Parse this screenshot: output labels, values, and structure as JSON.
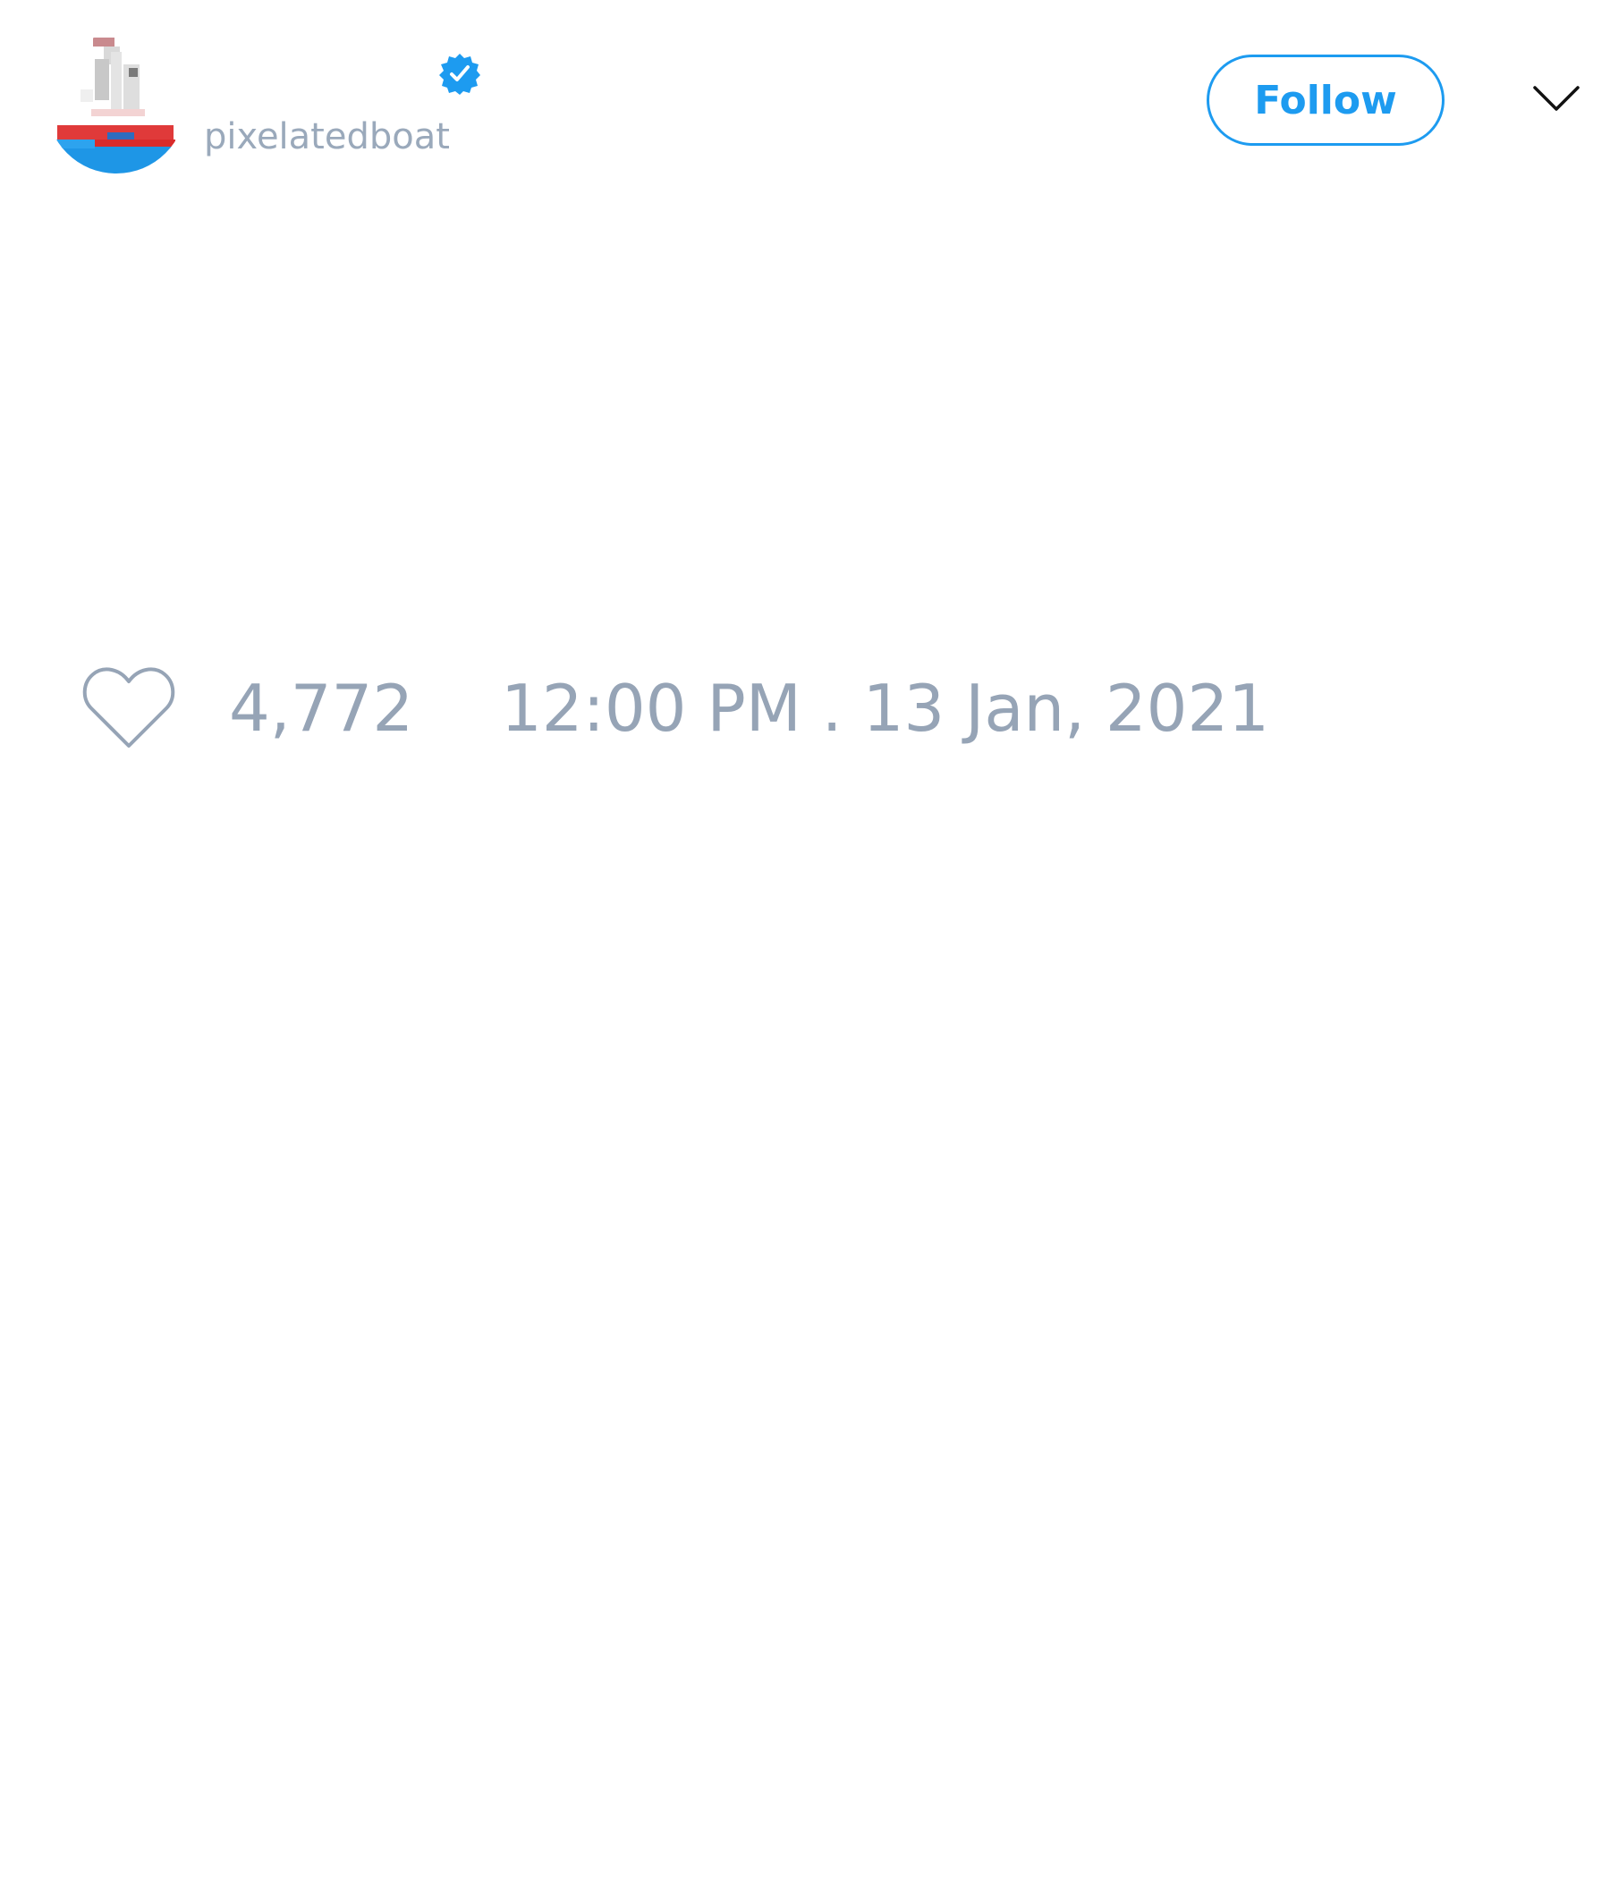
{
  "user": {
    "handle": "pixelatedboat",
    "verified": true,
    "avatar_icon": "pixel-boat-avatar-icon",
    "verified_icon": "verified-badge-icon"
  },
  "header": {
    "follow_label": "Follow",
    "menu_icon": "chevron-down-icon"
  },
  "engagement": {
    "like_icon": "heart-outline-icon",
    "like_count": "4,772",
    "timestamp": "12:00 PM . 13 Jan, 2021"
  },
  "colors": {
    "accent": "#1d9bf0",
    "muted_text": "#96a4b6",
    "background": "#ffffff"
  }
}
